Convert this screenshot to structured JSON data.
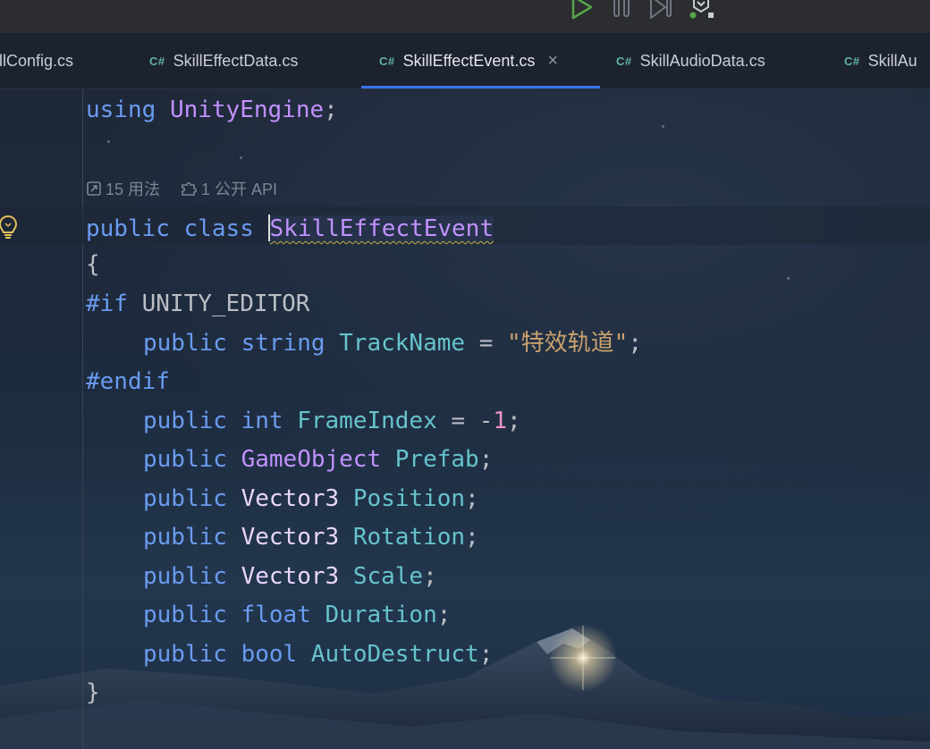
{
  "toolbar": {
    "buttons": [
      {
        "icon": "run-icon",
        "color": "#57a64a"
      },
      {
        "icon": "pause-icon",
        "color": "#6e7681"
      },
      {
        "icon": "step-icon",
        "color": "#6e7681"
      },
      {
        "icon": "attach-debugger-icon",
        "color": "#c9ced6"
      }
    ]
  },
  "tabs": [
    {
      "badge": "",
      "label": "illConfig.cs",
      "active": false
    },
    {
      "badge": "C#",
      "label": "SkillEffectData.cs",
      "active": false
    },
    {
      "badge": "C#",
      "label": "SkillEffectEvent.cs",
      "active": true,
      "close": "×"
    },
    {
      "badge": "C#",
      "label": "SkillAudioData.cs",
      "active": false
    },
    {
      "badge": "C#",
      "label": "SkillAu",
      "active": false
    }
  ],
  "inlay_hints": {
    "usages": "15 用法",
    "public_api": "1 公开 API"
  },
  "code": {
    "line1": {
      "kw": "using",
      "ns": "UnityEngine",
      "end": ";"
    },
    "line3": {
      "kw1": "public",
      "kw2": "class",
      "name": "SkillEffectEvent"
    },
    "line4": "{",
    "line5": {
      "dir": "#if",
      "sym": "UNITY_EDITOR"
    },
    "line6": {
      "kw": "public",
      "type": "string",
      "field": "TrackName",
      "eq": " = ",
      "str": "\"特效轨道\"",
      "end": ";"
    },
    "line7": {
      "dir": "#endif"
    },
    "line8": {
      "kw": "public",
      "type": "int",
      "field": "FrameIndex",
      "eq": " = -",
      "num": "1",
      "end": ";"
    },
    "line9": {
      "kw": "public",
      "type": "GameObject",
      "field": "Prefab",
      "end": ";"
    },
    "line10": {
      "kw": "public",
      "type": "Vector3",
      "field": "Position",
      "end": ";"
    },
    "line11": {
      "kw": "public",
      "type": "Vector3",
      "field": "Rotation",
      "end": ";"
    },
    "line12": {
      "kw": "public",
      "type": "Vector3",
      "field": "Scale",
      "end": ";"
    },
    "line13": {
      "kw": "public",
      "type": "float",
      "field": "Duration",
      "end": ";"
    },
    "line14": {
      "kw": "public",
      "type": "bool",
      "field": "AutoDestruct",
      "end": ";"
    },
    "line15": "}"
  },
  "colors": {
    "keyword": "#6a9bf0",
    "type": "#c191ff",
    "field": "#66c3cc",
    "string": "#c9a26d",
    "number": "#ed94c0",
    "tab_active_underline": "#3574f0"
  }
}
